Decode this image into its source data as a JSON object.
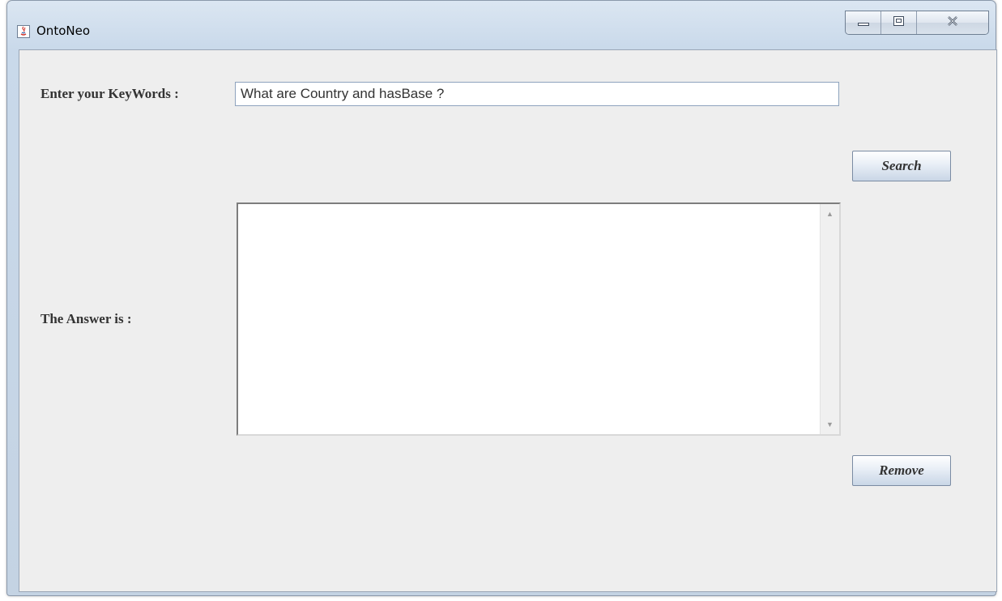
{
  "window": {
    "title": "OntoNeo"
  },
  "form": {
    "keywords_label": "Enter your KeyWords :",
    "keywords_value": "What are Country and hasBase ?",
    "answer_label": "The Answer is :",
    "answer_value": "",
    "search_button": "Search",
    "remove_button": "Remove"
  },
  "icons": {
    "app": "java-app-icon",
    "minimize": "minimize-icon",
    "maximize": "maximize-icon",
    "close": "close-icon",
    "scroll_up": "scroll-up-arrow-icon",
    "scroll_down": "scroll-down-arrow-icon"
  }
}
